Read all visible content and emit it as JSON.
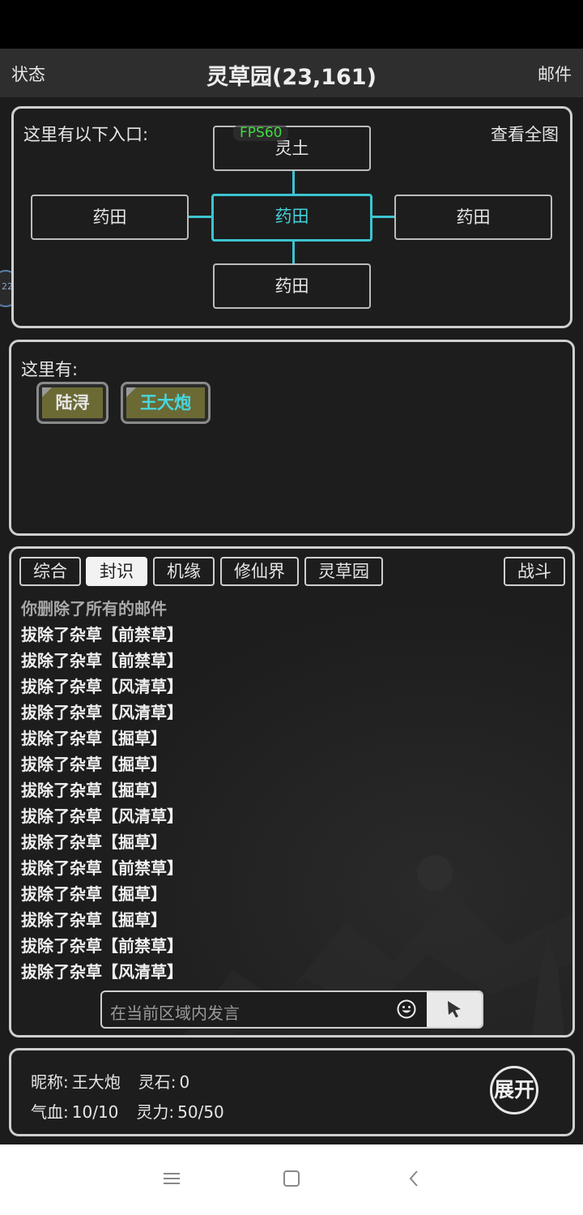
{
  "header": {
    "left": "状态",
    "title": "灵草园(23,161)",
    "right": "邮件"
  },
  "fps": "FPS60",
  "side_tab": "22",
  "map": {
    "label": "这里有以下入口:",
    "view_all": "查看全图",
    "nodes": {
      "north": "灵土",
      "west": "药田",
      "center": "药田",
      "east": "药田",
      "south": "药田"
    }
  },
  "here": {
    "label": "这里有:",
    "npcs": [
      "陆浔",
      "王大炮"
    ]
  },
  "chat": {
    "tabs": [
      "综合",
      "封识",
      "机缘",
      "修仙界",
      "灵草园",
      "战斗"
    ],
    "active_tab": "封识",
    "messages": [
      "你删除了所有的邮件",
      "拔除了杂草【前禁草】",
      "拔除了杂草【前禁草】",
      "拔除了杂草【风清草】",
      "拔除了杂草【风清草】",
      "拔除了杂草【掘草】",
      "拔除了杂草【掘草】",
      "拔除了杂草【掘草】",
      "拔除了杂草【风清草】",
      "拔除了杂草【掘草】",
      "拔除了杂草【前禁草】",
      "拔除了杂草【掘草】",
      "拔除了杂草【掘草】",
      "拔除了杂草【前禁草】",
      "拔除了杂草【风清草】"
    ],
    "input_placeholder": "在当前区域内发言"
  },
  "stats": {
    "nickname_label": "昵称:",
    "nickname": "王大炮",
    "stone_label": "灵石:",
    "stone": "0",
    "hp_label": "气血:",
    "hp": "10/10",
    "mp_label": "灵力:",
    "mp": "50/50",
    "expand": "展开"
  },
  "colors": {
    "accent": "#3cc4cf",
    "npc_bg": "#6b6a35",
    "fps": "#3fdc3f"
  },
  "icons": [
    "emoji-icon",
    "send-cursor-icon",
    "menu-icon",
    "home-square-icon",
    "back-chevron-icon"
  ]
}
